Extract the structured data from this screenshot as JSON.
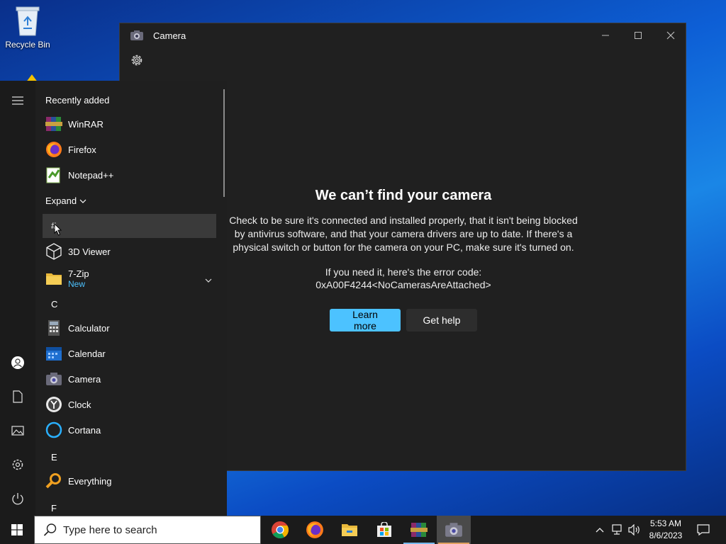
{
  "desktop": {
    "recycle_bin_label": "Recycle Bin"
  },
  "camera_window": {
    "title": "Camera",
    "heading": "We can’t find your camera",
    "body": "Check to be sure it's connected and installed properly, that it isn't being blocked by antivirus software, and that your camera drivers are up to date. If there's a physical switch or button for the camera on your PC, make sure it's turned on.",
    "error_label": "If you need it, here's the error code:",
    "error_code": "0xA00F4244<NoCamerasAreAttached>",
    "learn_more_label": "Learn more",
    "get_help_label": "Get help",
    "accent_color": "#4cc2ff"
  },
  "start_menu": {
    "recently_added_label": "Recently added",
    "recent_apps": [
      "WinRAR",
      "Firefox",
      "Notepad++"
    ],
    "expand_label": "Expand",
    "group_hash": "#",
    "apps_num": [
      {
        "name": "3D Viewer"
      },
      {
        "name": "7-Zip",
        "badge": "New"
      }
    ],
    "group_c": "C",
    "apps_c": [
      "Calculator",
      "Calendar",
      "Camera",
      "Clock",
      "Cortana"
    ],
    "group_e": "E",
    "apps_e": [
      "Everything"
    ],
    "group_f": "F"
  },
  "taskbar": {
    "search_placeholder": "Type here to search",
    "pinned_apps": [
      "chrome-icon",
      "firefox-icon",
      "file-explorer-icon",
      "store-icon",
      "winrar-icon",
      "camera-icon"
    ],
    "time": "5:53 AM",
    "date": "8/6/2023"
  }
}
